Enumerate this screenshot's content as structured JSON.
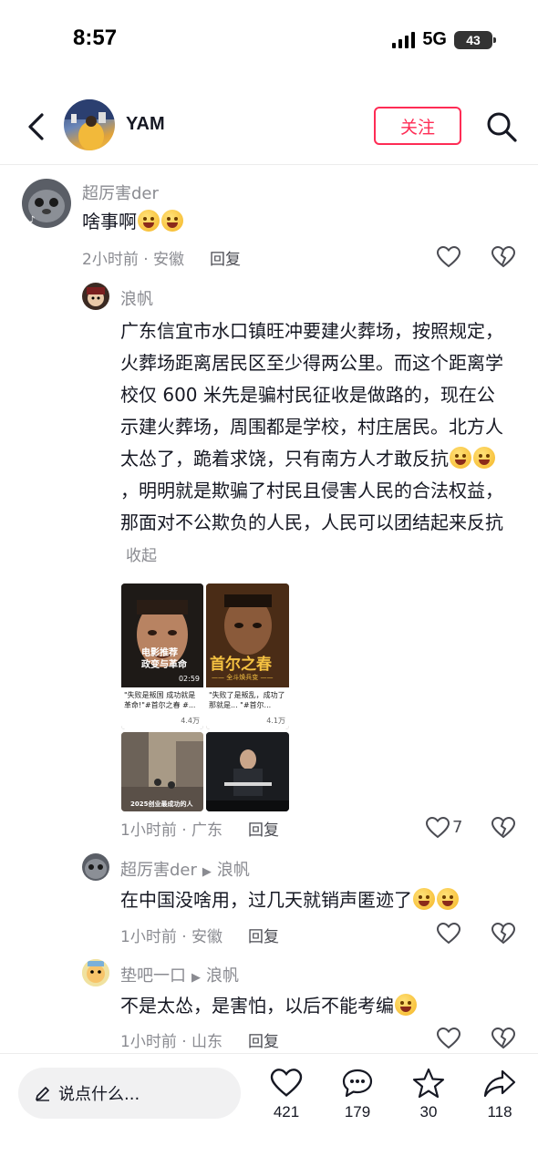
{
  "status": {
    "time": "8:57",
    "network": "5G",
    "battery": "43"
  },
  "nav": {
    "username": "YAM",
    "follow_label": "关注"
  },
  "comments": [
    {
      "user": "超厉害der",
      "text": "啥事啊",
      "meta": "2小时前 · 安徽",
      "reply_label": "回复"
    },
    {
      "user": "浪帆",
      "text": "广东信宜市水口镇旺冲要建火葬场，按照规定，火葬场距离居民区至少得两公里。而这个距离学校仅 600 米先是骗村民征收是做路的，现在公示建火葬场，周围都是学校，村庄居民。北方人太怂了，跪着求饶，只有南方人才敢反抗",
      "text_tail": "，明明就是欺骗了村民且侵害人民的合法权益，那面对不公欺负的人民，人民可以团结起来反抗",
      "collapse": "收起",
      "meta": "1小时前 · 广东",
      "reply_label": "回复",
      "likes": "7",
      "media": [
        {
          "overlay": "电影推荐\n政变与革命",
          "duration": "02:59",
          "caption": "\"失败是叛国 成功就是革命!\"#首尔之春 #...",
          "likes": "4.4万"
        },
        {
          "overlay": "首尔之春",
          "sub": "—— 全斗焕兵变 ——",
          "caption": "\"失败了是叛乱，成功了那就是... \"#首尔...",
          "likes": "4.1万"
        },
        {
          "overlay": "2025创业最成功的人"
        },
        {
          "overlay": ""
        }
      ]
    },
    {
      "user": "超厉害der",
      "reply_to": "浪帆",
      "text": "在中国没啥用，过几天就销声匿迹了",
      "meta": "1小时前 · 安徽",
      "reply_label": "回复"
    },
    {
      "user": "垫吧一口",
      "reply_to": "浪帆",
      "text": "不是太怂，是害怕，以后不能考编",
      "meta": "1小时前 · 山东",
      "reply_label": "回复"
    }
  ],
  "bottom": {
    "input_placeholder": "说点什么...",
    "likes": "421",
    "comments": "179",
    "favorites": "30",
    "shares": "118"
  },
  "colors": {
    "accent": "#fe2c55",
    "secondary_text": "#8a8b91"
  }
}
